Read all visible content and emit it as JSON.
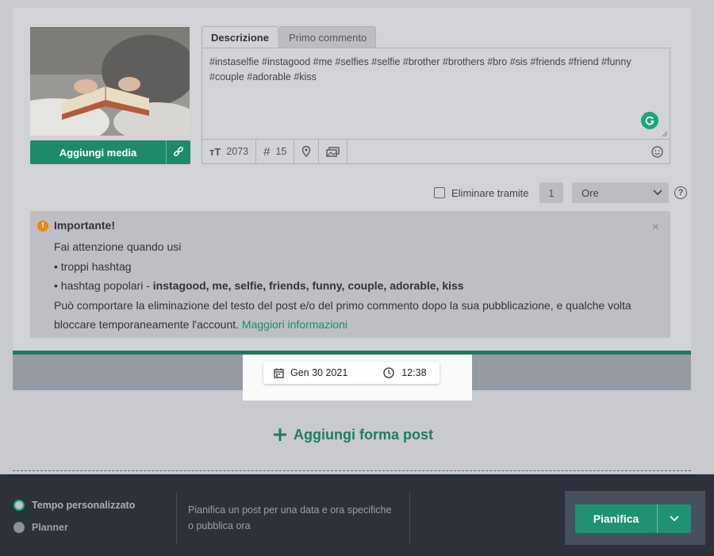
{
  "tabs": [
    {
      "label": "Descrizione",
      "active": true
    },
    {
      "label": "Primo commento",
      "active": false
    }
  ],
  "editor": {
    "text": "#instaselfie #instagood #me #selfies #selfie #brother #brothers #bro #sis #friends #friend #funny #couple #adorable #kiss"
  },
  "media": {
    "add_label": "Aggiungi media"
  },
  "toolbar": {
    "char_count": "2073",
    "hashtag_count": "15"
  },
  "delete_option": {
    "label": "Eliminare tramite",
    "value": "1",
    "unit": "Ore",
    "checked": false
  },
  "alert": {
    "title": "Importante!",
    "line1": "Fai attenzione quando usi",
    "line2": "• troppi hashtag",
    "line3_prefix": "• hashtag popolari - ",
    "line3_bold": "instagood, me, selfie, friends, funny, couple, adorable, kiss",
    "line4": "Può comportare la eliminazione del testo del post e/o del primo commento dopo la sua pubblicazione, e qualche volta bloccare temporaneamente l'account.",
    "link": "Maggiori informazioni"
  },
  "schedule": {
    "date": "Gen 30 2021",
    "time": "12:38"
  },
  "add_form_label": "Aggiungi forma post",
  "footer": {
    "radio_custom": "Tempo personalizzato",
    "radio_planner": "Planner",
    "description": "Pianifica un post per una data e ora specifiche o pubblica ora",
    "schedule_button": "Pianifica"
  },
  "colors": {
    "accent": "#1e8a6b",
    "footer_bg": "#2c323d",
    "warning": "#e68a12"
  }
}
